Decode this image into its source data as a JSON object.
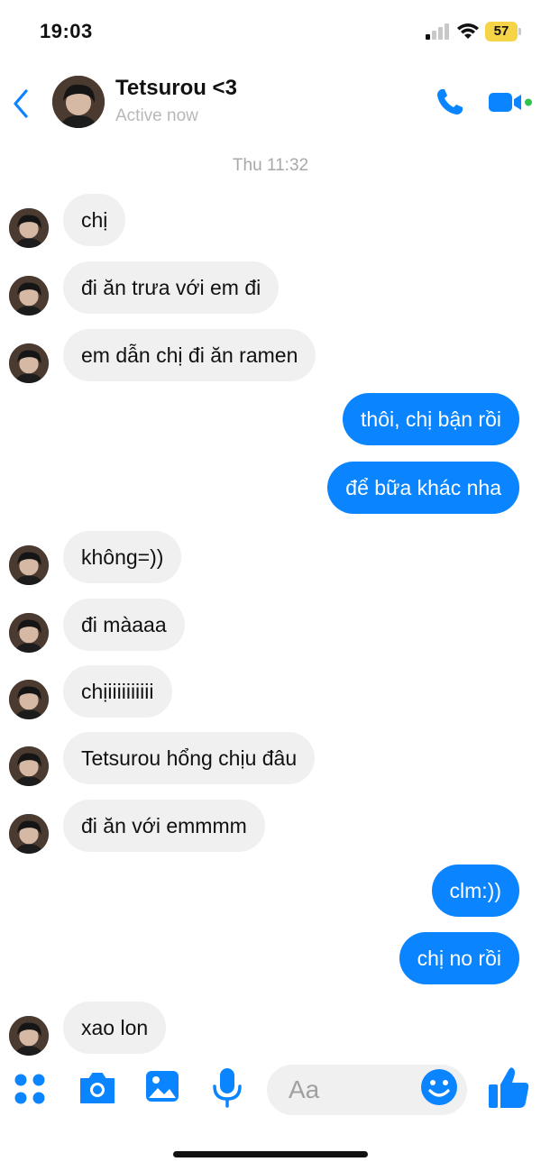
{
  "status_bar": {
    "time": "19:03",
    "battery": "57"
  },
  "header": {
    "contact_name": "Tetsurou <3",
    "status": "Active now"
  },
  "timestamp": "Thu 11:32",
  "messages": [
    {
      "from": "them",
      "text": "chị"
    },
    {
      "from": "them",
      "text": "đi ăn trưa với em đi"
    },
    {
      "from": "them",
      "text": "em dẫn chị đi ăn ramen"
    },
    {
      "from": "me",
      "text": "thôi, chị bận rồi"
    },
    {
      "from": "me",
      "text": "để bữa khác nha"
    },
    {
      "from": "them",
      "text": "không=))"
    },
    {
      "from": "them",
      "text": "đi màaaa"
    },
    {
      "from": "them",
      "text": "chịiiiiiiiiii"
    },
    {
      "from": "them",
      "text": "Tetsurou hổng chịu đâu"
    },
    {
      "from": "them",
      "text": "đi ăn với emmmm"
    },
    {
      "from": "me",
      "text": "clm:))"
    },
    {
      "from": "me",
      "text": "chị no rồi"
    },
    {
      "from": "them",
      "text": "xao lon"
    }
  ],
  "composer": {
    "placeholder": "Aa"
  },
  "colors": {
    "accent": "#0a84ff",
    "incoming_bubble": "#f0f0f0",
    "battery": "#f5d547"
  },
  "icons": [
    "back-icon",
    "phone-icon",
    "video-icon",
    "apps-icon",
    "camera-icon",
    "gallery-icon",
    "microphone-icon",
    "emoji-icon",
    "like-icon"
  ]
}
